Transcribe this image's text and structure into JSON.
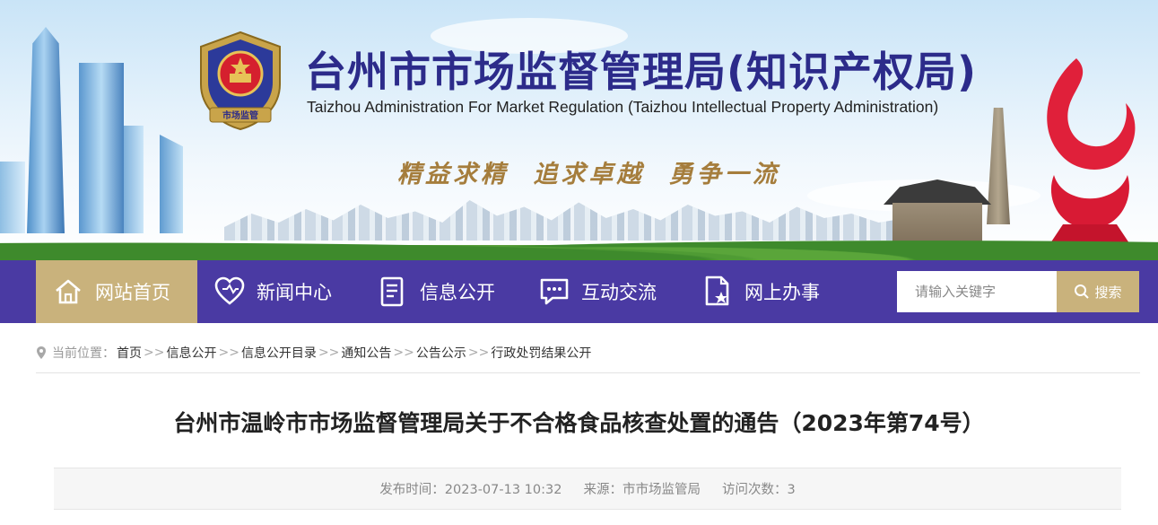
{
  "header": {
    "title_cn": "台州市市场监督管理局(知识产权局)",
    "title_en": "Taizhou Administration For Market Regulation (Taizhou Intellectual Property Administration)",
    "slogan": "精益求精 追求卓越 勇争一流",
    "emblem_text": "市场监管"
  },
  "nav": {
    "items": [
      {
        "label": "网站首页",
        "icon": "home-icon",
        "active": true
      },
      {
        "label": "新闻中心",
        "icon": "heart-icon",
        "active": false
      },
      {
        "label": "信息公开",
        "icon": "document-icon",
        "active": false
      },
      {
        "label": "互动交流",
        "icon": "chat-icon",
        "active": false
      },
      {
        "label": "网上办事",
        "icon": "file-star-icon",
        "active": false
      }
    ],
    "colors": {
      "bar": "#4a3aa3",
      "active": "#c9b27c"
    }
  },
  "search": {
    "placeholder": "请输入关键字",
    "button_label": "搜索"
  },
  "breadcrumb": {
    "label": "当前位置：",
    "items": [
      "首页",
      "信息公开",
      "信息公开目录",
      "通知公告",
      "公告公示",
      "行政处罚结果公开"
    ],
    "separator": ">>"
  },
  "article": {
    "title": "台州市温岭市市场监督管理局关于不合格食品核查处置的通告（2023年第74号）",
    "publish_time": "发布时间：2023-07-13 10:32",
    "source": "来源：市市场监管局",
    "views": "访问次数：3"
  }
}
